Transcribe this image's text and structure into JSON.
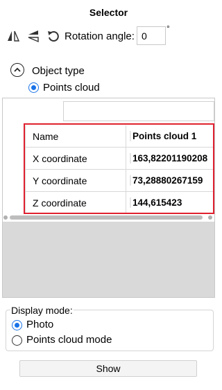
{
  "title": "Selector",
  "toolbar": {
    "icons": [
      "mirror-horizontal-icon",
      "mirror-vertical-icon",
      "rotate-icon"
    ],
    "rotation_label": "Rotation angle:",
    "rotation_value": "0",
    "degree_symbol": "°"
  },
  "object_type": {
    "label": "Object type",
    "options": [
      {
        "label": "Points cloud",
        "selected": true
      }
    ]
  },
  "grid": {
    "search_value": "",
    "rows": [
      {
        "key": "Name",
        "value": "Points cloud 1"
      },
      {
        "key": "X coordinate",
        "value": "163,82201190208"
      },
      {
        "key": "Y coordinate",
        "value": "73,28880267159"
      },
      {
        "key": "Z coordinate",
        "value": "144,615423"
      }
    ]
  },
  "display_mode": {
    "label": "Display mode:",
    "options": [
      {
        "label": "Photo",
        "selected": true
      },
      {
        "label": "Points cloud mode",
        "selected": false
      }
    ]
  },
  "show_label": "Show",
  "colors": {
    "accent": "#1a73e8",
    "highlight_frame": "#e0202e"
  }
}
